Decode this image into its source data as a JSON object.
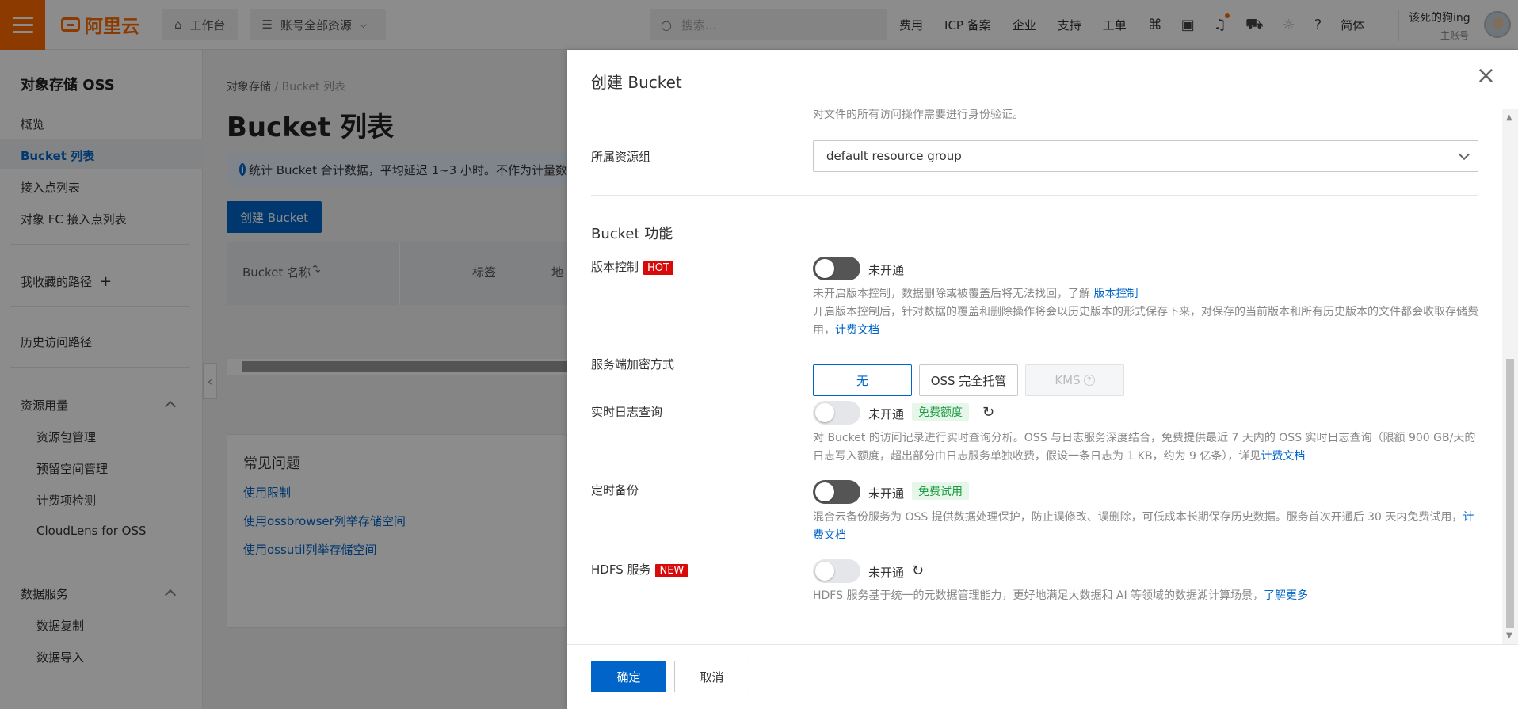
{
  "topbar": {
    "logo": "阿里云",
    "workbench": "工作台",
    "resources": "账号全部资源",
    "search_placeholder": "搜索...",
    "links": [
      "费用",
      "ICP 备案",
      "企业",
      "支持",
      "工单"
    ],
    "lang": "简体",
    "user_name": "该死的狗ing",
    "user_sub": "主账号"
  },
  "sidebar": {
    "title": "对象存储 OSS",
    "items": [
      "概览",
      "Bucket 列表",
      "接入点列表",
      "对象 FC 接入点列表"
    ],
    "favorites": "我收藏的路径",
    "history": "历史访问路径",
    "usage_group": "资源用量",
    "usage_items": [
      "资源包管理",
      "预留空间管理",
      "计费项检测",
      "CloudLens for OSS"
    ],
    "data_group": "数据服务",
    "data_items": [
      "数据复制",
      "数据导入"
    ]
  },
  "main": {
    "breadcrumb_root": "对象存储",
    "breadcrumb_sep": "/",
    "breadcrumb_current": "Bucket 列表",
    "title": "Bucket 列表",
    "alert": "统计 Bucket 合计数据，平均延迟 1~3 小时。不作为计量数",
    "create_button": "创建 Bucket",
    "columns": [
      "Bucket 名称",
      "标签",
      "地"
    ],
    "faq_title": "常见问题",
    "faq_links": [
      "使用限制",
      "使用ossbrowser列举存储空间",
      "使用ossutil列举存储空间"
    ]
  },
  "drawer": {
    "title": "创建 Bucket",
    "top_desc": "对文件的所有访问操作需要进行身份验证。",
    "resource_group_label": "所属资源组",
    "resource_group_value": "default resource group",
    "section_title": "Bucket 功能",
    "versioning": {
      "label": "版本控制",
      "badge": "HOT",
      "status": "未开通",
      "desc1": "未开启版本控制，数据删除或被覆盖后将无法找回，了解",
      "desc1_link": "版本控制",
      "desc2": "开启版本控制后，针对数据的覆盖和删除操作将会以历史版本的形式保存下来，对保存的当前版本和所有历史版本的文件都会收取存储费用，",
      "desc2_link": "计费文档"
    },
    "encryption": {
      "label": "服务端加密方式",
      "options": [
        "无",
        "OSS 完全托管",
        "KMS"
      ]
    },
    "realtime_log": {
      "label": "实时日志查询",
      "status": "未开通",
      "tag": "免费额度",
      "desc": "对 Bucket 的访问记录进行实时查询分析。OSS 与日志服务深度结合，免费提供最近 7 天内的 OSS 实时日志查询（限额 900 GB/天的日志写入额度，超出部分由日志服务单独收费，假设一条日志为 1 KB，约为 9 亿条），详见",
      "desc_link": "计费文档"
    },
    "backup": {
      "label": "定时备份",
      "status": "未开通",
      "tag": "免费试用",
      "desc": "混合云备份服务为 OSS 提供数据处理保护，防止误修改、误删除，可低成本长期保存历史数据。服务首次开通后 30 天内免费试用，",
      "desc_link": "计费文档"
    },
    "hdfs": {
      "label": "HDFS 服务",
      "badge": "NEW",
      "status": "未开通",
      "desc": "HDFS 服务基于统一的元数据管理能力，更好地满足大数据和 AI 等领域的数据湖计算场景，",
      "desc_link": "了解更多"
    },
    "ok": "确定",
    "cancel": "取消"
  }
}
